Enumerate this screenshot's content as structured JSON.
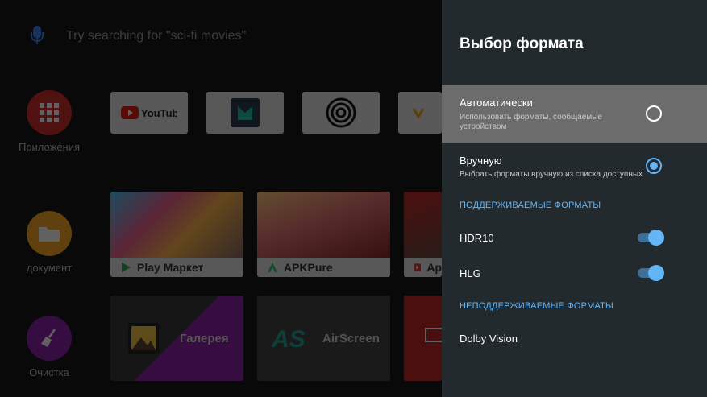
{
  "background": {
    "search_placeholder": "Try searching for \"sci-fi movies\"",
    "side_apps": [
      {
        "label": "Приложения",
        "color": "#d32f2f",
        "icon": "apps-grid-icon"
      },
      {
        "label": "документ",
        "color": "#f9a825",
        "icon": "folder-icon"
      },
      {
        "label": "Очистка",
        "color": "#8e24aa",
        "icon": "broom-icon"
      }
    ],
    "top_tiles": [
      {
        "label": "YouTube",
        "icon": "youtube-icon"
      },
      {
        "label": "",
        "icon": "bookmark-icon"
      },
      {
        "label": "",
        "icon": "circles-icon"
      },
      {
        "label": "",
        "icon": "partial-app-icon"
      }
    ],
    "featured_tiles": [
      {
        "label": "Play Маркет",
        "icon": "play-store-icon"
      },
      {
        "label": "APKPure",
        "icon": "apkpure-icon"
      },
      {
        "label": "Ap",
        "icon": "app-icon"
      }
    ],
    "bottom_tiles": [
      {
        "label": "Галерея",
        "icon": "gallery-icon"
      },
      {
        "label": "AirScreen",
        "icon": "airscreen-icon"
      },
      {
        "label": "",
        "icon": "cast-icon"
      }
    ]
  },
  "panel": {
    "title": "Выбор формата",
    "options": [
      {
        "title": "Автоматически",
        "description": "Использовать форматы, сообщаемые устройством",
        "checked": false
      },
      {
        "title": "Вручную",
        "description": "Выбрать форматы вручную из списка доступных",
        "checked": true
      }
    ],
    "supported_header": "ПОДДЕРЖИВАЕМЫЕ ФОРМАТЫ",
    "supported": [
      {
        "label": "HDR10",
        "enabled": true
      },
      {
        "label": "HLG",
        "enabled": true
      }
    ],
    "unsupported_header": "НЕПОДДЕРЖИВАЕМЫЕ ФОРМАТЫ",
    "unsupported": [
      {
        "label": "Dolby Vision"
      }
    ],
    "accent_color": "#64b5f6"
  }
}
